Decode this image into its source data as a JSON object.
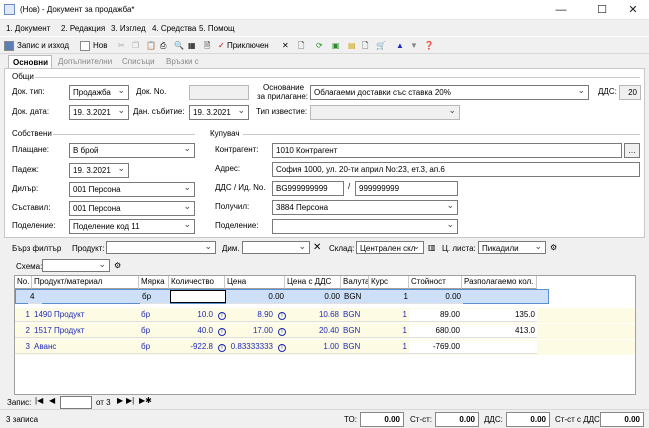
{
  "window": {
    "title": "(Нов) - Документ за продажба*"
  },
  "menu": [
    "1. Документ",
    "2. Редакция",
    "3. Изглед",
    "4. Средства",
    "5. Помощ"
  ],
  "toolbar": {
    "save_exit": "Запис и изход",
    "new": "Нов",
    "close_doc": "Приключен"
  },
  "tabs": [
    "Основни",
    "Допълнителни",
    "Списъци",
    "Връзки с документи"
  ],
  "general": {
    "group": "Общи",
    "doc_type_label": "Док. тип:",
    "doc_type": "Продажба",
    "doc_no_label": "Док. No.",
    "doc_no": "",
    "basis_label_1": "Основание",
    "basis_label_2": "за прилагане:",
    "basis": "Облагаеми доставки със ставка 20%",
    "vat_label": "ДДС:",
    "vat": "20",
    "doc_date_label": "Док. дата:",
    "doc_date": "19.  3.2021",
    "tax_date_label": "Дан. събитие:",
    "tax_date": "19.  3.2021",
    "notice_label": "Тип известие:",
    "notice": ""
  },
  "own": {
    "group": "Собствени",
    "payment_label": "Плащане:",
    "payment": "В брой",
    "due_label": "Падеж:",
    "due": "19.  3.2021",
    "dealer_label": "Дилър:",
    "dealer": "001 Персона",
    "author_label": "Съставил:",
    "author": "001 Персона",
    "division_label": "Поделение:",
    "division": "Поделение код 11"
  },
  "buyer": {
    "group": "Купувач",
    "contractor_label": "Контрагент:",
    "contractor": "1010 Контрагент",
    "address_label": "Адрес:",
    "address": "София 1000, ул. 20-ти април No:23, ет.3, ап.6",
    "vat_id_label": "ДДС / Ид. No.",
    "vat_id": "BG999999999",
    "id_no": "999999999",
    "receiver_label": "Получил:",
    "receiver": "3884 Персона",
    "division_label": "Поделение:",
    "division": ""
  },
  "filter": {
    "quick": "Бърз филтър",
    "product_label": "Продукт:",
    "dim_label": "Дим.",
    "store_label": "Склад:",
    "store": "Централен скл",
    "price_list_label": "Ц. листа:",
    "price_list": "Пикадили",
    "scheme_label": "Схема:"
  },
  "grid": {
    "headers": [
      "No.",
      "Продукт/материал",
      "Мярка",
      "Количество",
      "Цена",
      "Цена с ДДС",
      "Валута",
      "Курс",
      "Стойност",
      "Разполагаемо кол."
    ],
    "edit_row": {
      "no": "4",
      "unit": "бр",
      "price": "0.00",
      "price_vat": "0.00",
      "currency": "BGN",
      "rate": "1",
      "value": "0.00"
    },
    "rows": [
      {
        "no": "1",
        "product": "1490 Продукт",
        "unit": "бр",
        "qty": "10.0",
        "price": "8.90",
        "price_vat": "10.68",
        "currency": "BGN",
        "rate": "1",
        "value": "89.00",
        "avail": "135.0"
      },
      {
        "no": "2",
        "product": "1517 Продукт",
        "unit": "бр",
        "qty": "40.0",
        "price": "17.00",
        "price_vat": "20.40",
        "currency": "BGN",
        "rate": "1",
        "value": "680.00",
        "avail": "413.0"
      },
      {
        "no": "3",
        "product": "Аванс",
        "unit": "бр",
        "qty": "-922.8",
        "price": "0.83333333",
        "price_vat": "1.00",
        "currency": "BGN",
        "rate": "1",
        "value": "-769.00",
        "avail": ""
      }
    ]
  },
  "nav": {
    "record_label": "Запис:",
    "record": "",
    "of": "от 3"
  },
  "status": {
    "records": "3 записа",
    "to_label": "ТО:",
    "to": "0.00",
    "st_label": "Ст-ст:",
    "st": "0.00",
    "vat_label": "ДДС:",
    "vat": "0.00",
    "st_vat_label": "Ст-ст с ДДС:",
    "st_vat": "0.00"
  }
}
